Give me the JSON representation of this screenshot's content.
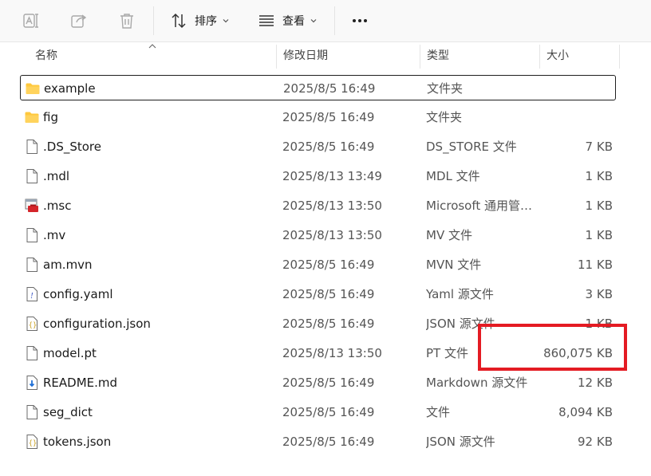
{
  "toolbar": {
    "rename_icon": "rename-icon",
    "share_icon": "share-icon",
    "delete_icon": "trash-icon",
    "sort_label": "排序",
    "view_label": "查看",
    "more_icon": "more-icon"
  },
  "columns": {
    "name": "名称",
    "modified": "修改日期",
    "type": "类型",
    "size": "大小"
  },
  "files": [
    {
      "name": "example",
      "modified": "2025/8/5 16:49",
      "type": "文件夹",
      "size": "",
      "icon": "folder",
      "selected": true
    },
    {
      "name": "fig",
      "modified": "2025/8/5 16:49",
      "type": "文件夹",
      "size": "",
      "icon": "folder"
    },
    {
      "name": ".DS_Store",
      "modified": "2025/8/5 16:49",
      "type": "DS_STORE 文件",
      "size": "7 KB",
      "icon": "file"
    },
    {
      "name": ".mdl",
      "modified": "2025/8/13 13:49",
      "type": "MDL 文件",
      "size": "1 KB",
      "icon": "file"
    },
    {
      "name": ".msc",
      "modified": "2025/8/13 13:50",
      "type": "Microsoft 通用管…",
      "size": "1 KB",
      "icon": "msc"
    },
    {
      "name": ".mv",
      "modified": "2025/8/13 13:50",
      "type": "MV 文件",
      "size": "1 KB",
      "icon": "file"
    },
    {
      "name": "am.mvn",
      "modified": "2025/8/5 16:49",
      "type": "MVN 文件",
      "size": "11 KB",
      "icon": "file"
    },
    {
      "name": "config.yaml",
      "modified": "2025/8/5 16:49",
      "type": "Yaml 源文件",
      "size": "3 KB",
      "icon": "yaml"
    },
    {
      "name": "configuration.json",
      "modified": "2025/8/5 16:49",
      "type": "JSON 源文件",
      "size": "1 KB",
      "icon": "json"
    },
    {
      "name": "model.pt",
      "modified": "2025/8/13 13:50",
      "type": "PT 文件",
      "size": "860,075 KB",
      "icon": "file"
    },
    {
      "name": "README.md",
      "modified": "2025/8/5 16:49",
      "type": "Markdown 源文件",
      "size": "12 KB",
      "icon": "markdown"
    },
    {
      "name": "seg_dict",
      "modified": "2025/8/5 16:49",
      "type": "文件",
      "size": "8,094 KB",
      "icon": "file"
    },
    {
      "name": "tokens.json",
      "modified": "2025/8/5 16:49",
      "type": "JSON 源文件",
      "size": "92 KB",
      "icon": "json"
    }
  ],
  "colors": {
    "highlight": "#e41b23",
    "folder": "#ffc83d"
  }
}
